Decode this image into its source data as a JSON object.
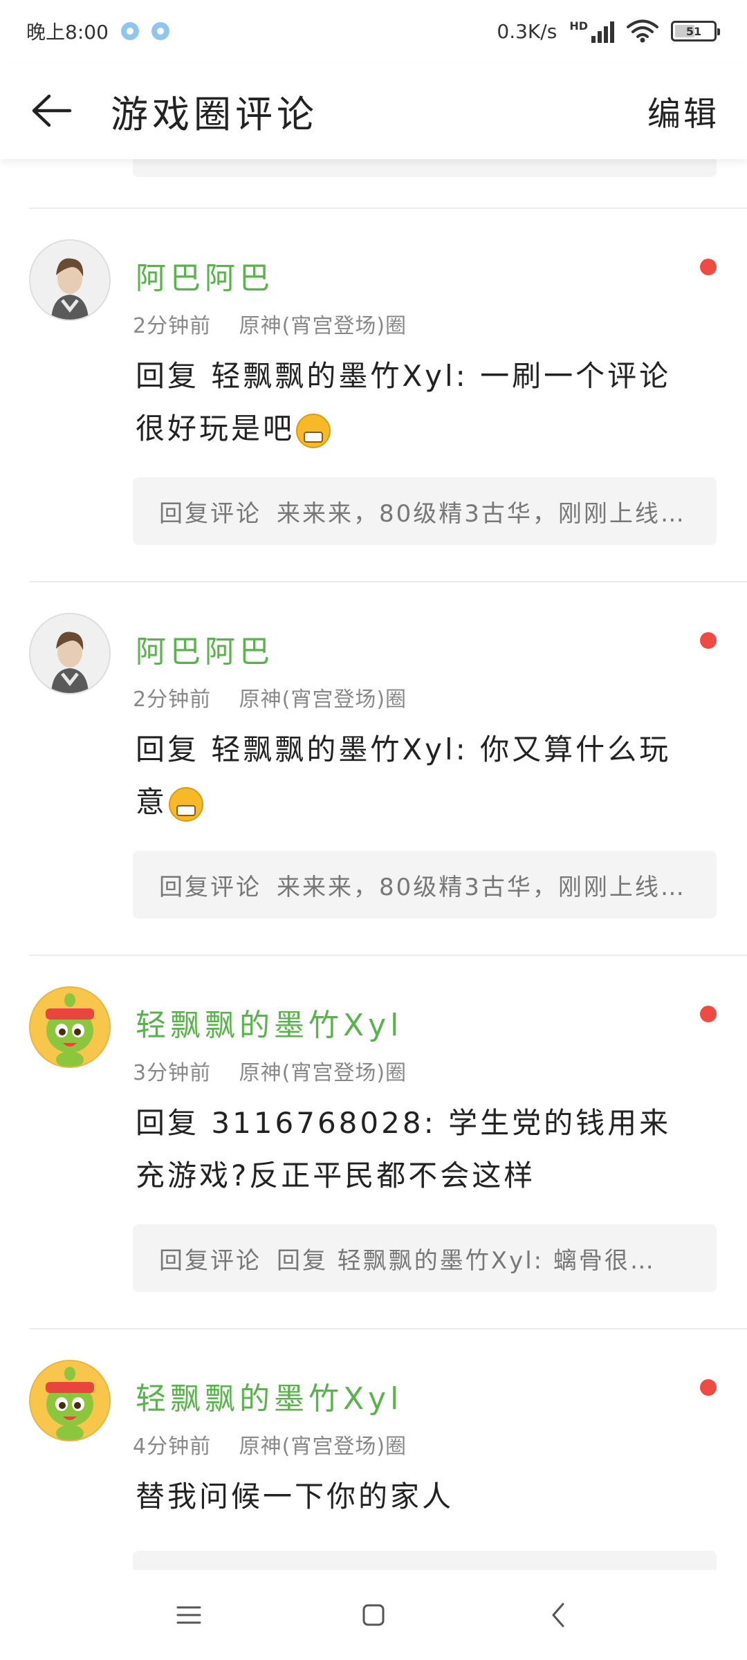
{
  "status_bar": {
    "time": "晚上8:00",
    "network_speed": "0.3K/s",
    "signal_label": "HD",
    "battery": "51"
  },
  "header": {
    "title": "游戏圈评论",
    "edit_label": "编辑"
  },
  "comments": [
    {
      "username": "阿巴阿巴",
      "time": "2分钟前",
      "circle": "原神(宵宫登场)圈",
      "text": "回复 轻飘飘的墨竹Xyl: 一刷一个评论很好玩是吧",
      "emoji": "grimacing-emoji",
      "reply_prefix": "回复评论",
      "reply_quote": "来来来，80级精3古华，刚刚上线…",
      "avatar": "boy-avatar"
    },
    {
      "username": "阿巴阿巴",
      "time": "2分钟前",
      "circle": "原神(宵宫登场)圈",
      "text": "回复 轻飘飘的墨竹Xyl: 你又算什么玩意",
      "emoji": "grimacing-emoji",
      "reply_prefix": "回复评论",
      "reply_quote": "来来来，80级精3古华，刚刚上线…",
      "avatar": "boy-avatar"
    },
    {
      "username": "轻飘飘的墨竹Xyl",
      "time": "3分钟前",
      "circle": "原神(宵宫登场)圈",
      "text": "回复 3116768028: 学生党的钱用来充游戏?反正平民都不会这样",
      "reply_prefix": "回复评论",
      "reply_quote": "回复 轻飘飘的墨竹Xyl: 螭骨很…",
      "avatar": "mascot-avatar"
    },
    {
      "username": "轻飘飘的墨竹Xyl",
      "time": "4分钟前",
      "circle": "原神(宵宫登场)圈",
      "text": "替我问候一下你的家人",
      "avatar": "mascot-avatar"
    }
  ],
  "colors": {
    "username": "#59b24b",
    "unread_dot": "#ef4b43",
    "reply_box_bg": "#f4f4f4"
  }
}
